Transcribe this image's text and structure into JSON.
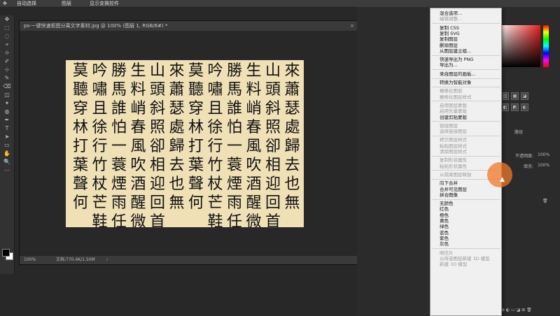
{
  "topbar": {
    "item1": "自动选择",
    "item2": "图层",
    "item3": "显示变换控件"
  },
  "toolbar": {
    "tools": [
      "✥",
      "⬚",
      "◌",
      "⌖",
      "⟐",
      "✐",
      "⊹",
      "✎",
      "⌫",
      "◫",
      "✦",
      "◍",
      "✒",
      "T",
      "➤",
      "▭",
      "✋",
      "🔍",
      "⋯"
    ]
  },
  "document": {
    "title": "ps-一键快速抠图分离文字素材.jpg @ 100% (图层 1, RGB/8#) *",
    "close": "×",
    "zoom": "100%",
    "docinfo": "文档:770.4K/1.50M",
    "arrow": "›"
  },
  "calligraphy": {
    "columns": [
      [
        "莫",
        "聽",
        "穿",
        "林",
        "打",
        "葉",
        "聲",
        "何"
      ],
      [
        "吟",
        "嘯",
        "且",
        "徐",
        "行",
        "竹",
        "杖",
        "芒",
        "鞋"
      ],
      [
        "勝",
        "馬",
        "誰",
        "怕",
        "一",
        "蓑",
        "煙",
        "雨",
        "任"
      ],
      [
        "生",
        "料",
        "峭",
        "春",
        "風",
        "吹",
        "酒",
        "醒",
        "微"
      ],
      [
        "山",
        "頭",
        "斜",
        "照",
        "卻",
        "相",
        "迎",
        "回",
        "首"
      ],
      [
        "來",
        "蕭",
        "瑟",
        "處",
        "歸",
        "去",
        "也",
        "無"
      ],
      [
        "莫",
        "聽",
        "穿",
        "林",
        "打",
        "葉",
        "聲",
        "何"
      ],
      [
        "吟",
        "嘯",
        "且",
        "徐",
        "行",
        "竹",
        "杖",
        "芒",
        "鞋"
      ],
      [
        "勝",
        "馬",
        "誰",
        "怕",
        "一",
        "蓑",
        "煙",
        "雨",
        "任"
      ],
      [
        "生",
        "料",
        "峭",
        "春",
        "風",
        "吹",
        "酒",
        "醒",
        "微"
      ],
      [
        "山",
        "頭",
        "斜",
        "照",
        "卻",
        "相",
        "迎",
        "回",
        "首"
      ],
      [
        "來",
        "蕭",
        "瑟",
        "處",
        "歸",
        "去",
        "也",
        "無"
      ]
    ]
  },
  "panel": {
    "opacity_label": "不透明度:",
    "opacity_value": "100%",
    "fill_label": "填充:",
    "fill_value": "100%",
    "tab_label": "路径"
  },
  "menu": {
    "items": [
      {
        "label": "混合选项...",
        "disabled": false
      },
      {
        "label": "编辑调整...",
        "disabled": true
      },
      {
        "sep": true
      },
      {
        "label": "复制 CSS",
        "disabled": false
      },
      {
        "label": "复制 SVG",
        "disabled": false
      },
      {
        "label": "复制图层",
        "disabled": false
      },
      {
        "label": "删除图层",
        "disabled": false
      },
      {
        "label": "从图层建立组...",
        "disabled": false
      },
      {
        "sep": true
      },
      {
        "label": "快速导出为 PNG",
        "disabled": false
      },
      {
        "label": "导出为...",
        "disabled": false
      },
      {
        "sep": true
      },
      {
        "label": "来自图层的画板...",
        "disabled": false
      },
      {
        "sep": true
      },
      {
        "label": "转换为智能对象",
        "disabled": false
      },
      {
        "sep": true
      },
      {
        "label": "栅格化图层",
        "disabled": true
      },
      {
        "label": "栅格化图层样式",
        "disabled": true
      },
      {
        "sep": true
      },
      {
        "label": "启用图层蒙版",
        "disabled": true
      },
      {
        "label": "启用矢量蒙版",
        "disabled": true
      },
      {
        "label": "创建剪贴蒙版",
        "disabled": false
      },
      {
        "sep": true
      },
      {
        "label": "链接图层",
        "disabled": true
      },
      {
        "label": "选择链接图层",
        "disabled": true
      },
      {
        "sep": true
      },
      {
        "label": "拷贝图层样式",
        "disabled": true
      },
      {
        "label": "粘贴图层样式",
        "disabled": true
      },
      {
        "label": "清除图层样式",
        "disabled": true
      },
      {
        "sep": true
      },
      {
        "label": "复制形状属性",
        "disabled": true
      },
      {
        "label": "粘贴形状属性",
        "disabled": true
      },
      {
        "sep": true
      },
      {
        "label": "从隔离图层释放",
        "disabled": true
      },
      {
        "sep": true
      },
      {
        "label": "向下合并",
        "disabled": false
      },
      {
        "label": "合并可见图层",
        "disabled": false
      },
      {
        "label": "拼合图像",
        "disabled": false
      },
      {
        "sep": true
      },
      {
        "label": "无颜色",
        "disabled": false
      },
      {
        "label": "红色",
        "disabled": false
      },
      {
        "label": "橙色",
        "disabled": false
      },
      {
        "label": "黄色",
        "disabled": false
      },
      {
        "label": "绿色",
        "disabled": false
      },
      {
        "label": "蓝色",
        "disabled": false
      },
      {
        "label": "紫色",
        "disabled": false
      },
      {
        "label": "灰色",
        "disabled": false
      },
      {
        "sep": true
      },
      {
        "label": "明信片",
        "disabled": true
      },
      {
        "label": "从所选图层新建 3D 模型",
        "disabled": true
      },
      {
        "label": "新建 3D 模型",
        "disabled": true
      }
    ]
  },
  "colors": {
    "canvas": "#efe0b6",
    "accent": "#f07828",
    "menu_bg": "#f0f0f0"
  }
}
